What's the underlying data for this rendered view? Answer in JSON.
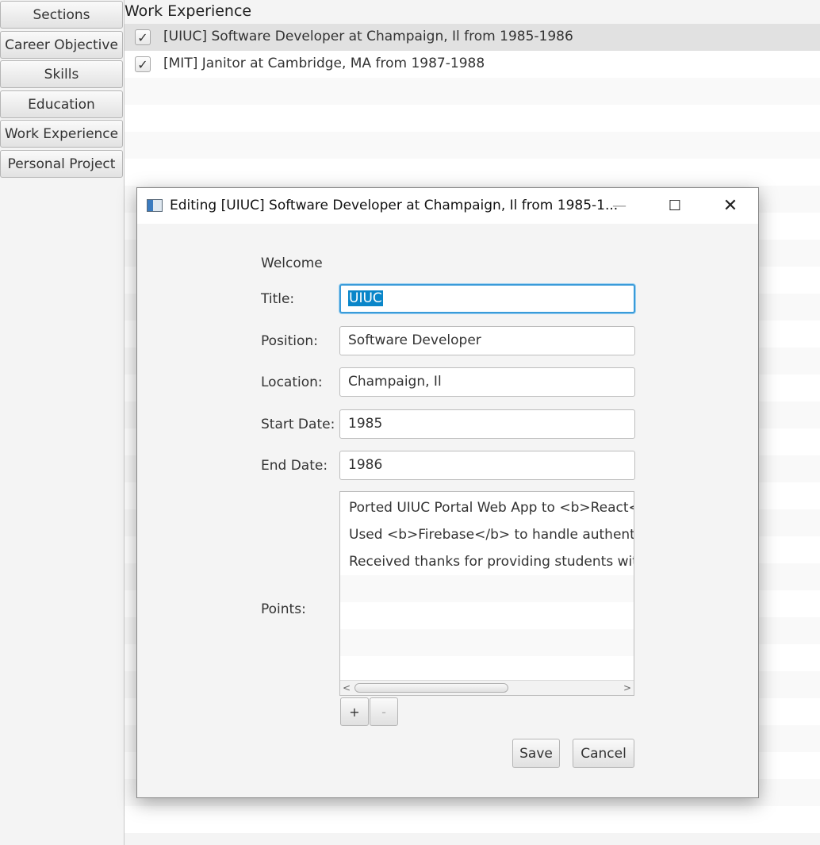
{
  "sidebar": {
    "items": [
      {
        "label": "Sections"
      },
      {
        "label": "Career Objective"
      },
      {
        "label": "Skills"
      },
      {
        "label": "Education"
      },
      {
        "label": "Work Experience"
      },
      {
        "label": "Personal Project"
      }
    ]
  },
  "main": {
    "title": "Work Experience",
    "entries": [
      {
        "label": "[UIUC] Software Developer at Champaign, Il from 1985-1986",
        "checked": true,
        "selected": true
      },
      {
        "label": "[MIT] Janitor at Cambridge, MA from 1987-1988",
        "checked": true,
        "selected": false
      }
    ]
  },
  "dialog": {
    "title": "Editing [UIUC] Software Developer at Champaign, Il from 1985-1...",
    "welcome": "Welcome",
    "fields": {
      "title": {
        "label": "Title:",
        "value": "UIUC"
      },
      "position": {
        "label": "Position:",
        "value": "Software Developer"
      },
      "location": {
        "label": "Location:",
        "value": "Champaign, Il"
      },
      "start_date": {
        "label": "Start Date:",
        "value": "1985"
      },
      "end_date": {
        "label": "End Date:",
        "value": "1986"
      }
    },
    "points": {
      "label": "Points:",
      "items": [
        "Ported UIUC Portal Web App to <b>React</b>",
        "Used <b>Firebase</b> to handle authentication",
        "Received thanks for providing students with e"
      ]
    },
    "add_label": "+",
    "remove_label": "-",
    "save_label": "Save",
    "cancel_label": "Cancel"
  },
  "colors": {
    "accent": "#0a86c9",
    "focus_ring": "#3a9bd9"
  }
}
